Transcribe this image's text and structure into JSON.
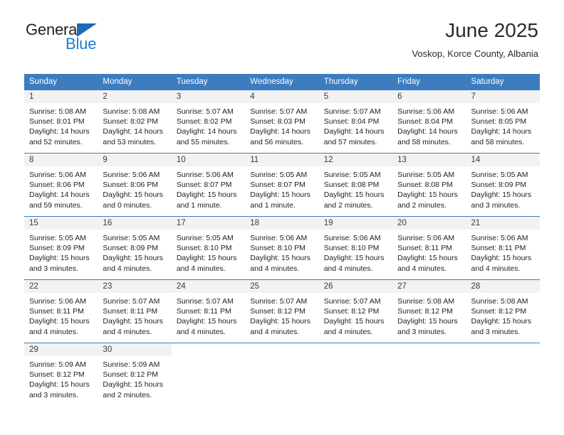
{
  "brand": {
    "line1": "General",
    "line2": "Blue",
    "triangle_color": "#1b6cb5",
    "blue_text_color": "#1b7fd4"
  },
  "header": {
    "title": "June 2025",
    "subtitle": "Voskop, Korce County, Albania"
  },
  "theme": {
    "header_bg": "#3c7cbf",
    "daynum_bg": "#f2f2f2",
    "border": "#3c7cbf"
  },
  "weekday_headers": [
    "Sunday",
    "Monday",
    "Tuesday",
    "Wednesday",
    "Thursday",
    "Friday",
    "Saturday"
  ],
  "weeks": [
    [
      {
        "day": "1",
        "sunrise": "Sunrise: 5:08 AM",
        "sunset": "Sunset: 8:01 PM",
        "daylight1": "Daylight: 14 hours",
        "daylight2": "and 52 minutes."
      },
      {
        "day": "2",
        "sunrise": "Sunrise: 5:08 AM",
        "sunset": "Sunset: 8:02 PM",
        "daylight1": "Daylight: 14 hours",
        "daylight2": "and 53 minutes."
      },
      {
        "day": "3",
        "sunrise": "Sunrise: 5:07 AM",
        "sunset": "Sunset: 8:02 PM",
        "daylight1": "Daylight: 14 hours",
        "daylight2": "and 55 minutes."
      },
      {
        "day": "4",
        "sunrise": "Sunrise: 5:07 AM",
        "sunset": "Sunset: 8:03 PM",
        "daylight1": "Daylight: 14 hours",
        "daylight2": "and 56 minutes."
      },
      {
        "day": "5",
        "sunrise": "Sunrise: 5:07 AM",
        "sunset": "Sunset: 8:04 PM",
        "daylight1": "Daylight: 14 hours",
        "daylight2": "and 57 minutes."
      },
      {
        "day": "6",
        "sunrise": "Sunrise: 5:06 AM",
        "sunset": "Sunset: 8:04 PM",
        "daylight1": "Daylight: 14 hours",
        "daylight2": "and 58 minutes."
      },
      {
        "day": "7",
        "sunrise": "Sunrise: 5:06 AM",
        "sunset": "Sunset: 8:05 PM",
        "daylight1": "Daylight: 14 hours",
        "daylight2": "and 58 minutes."
      }
    ],
    [
      {
        "day": "8",
        "sunrise": "Sunrise: 5:06 AM",
        "sunset": "Sunset: 8:06 PM",
        "daylight1": "Daylight: 14 hours",
        "daylight2": "and 59 minutes."
      },
      {
        "day": "9",
        "sunrise": "Sunrise: 5:06 AM",
        "sunset": "Sunset: 8:06 PM",
        "daylight1": "Daylight: 15 hours",
        "daylight2": "and 0 minutes."
      },
      {
        "day": "10",
        "sunrise": "Sunrise: 5:06 AM",
        "sunset": "Sunset: 8:07 PM",
        "daylight1": "Daylight: 15 hours",
        "daylight2": "and 1 minute."
      },
      {
        "day": "11",
        "sunrise": "Sunrise: 5:05 AM",
        "sunset": "Sunset: 8:07 PM",
        "daylight1": "Daylight: 15 hours",
        "daylight2": "and 1 minute."
      },
      {
        "day": "12",
        "sunrise": "Sunrise: 5:05 AM",
        "sunset": "Sunset: 8:08 PM",
        "daylight1": "Daylight: 15 hours",
        "daylight2": "and 2 minutes."
      },
      {
        "day": "13",
        "sunrise": "Sunrise: 5:05 AM",
        "sunset": "Sunset: 8:08 PM",
        "daylight1": "Daylight: 15 hours",
        "daylight2": "and 2 minutes."
      },
      {
        "day": "14",
        "sunrise": "Sunrise: 5:05 AM",
        "sunset": "Sunset: 8:09 PM",
        "daylight1": "Daylight: 15 hours",
        "daylight2": "and 3 minutes."
      }
    ],
    [
      {
        "day": "15",
        "sunrise": "Sunrise: 5:05 AM",
        "sunset": "Sunset: 8:09 PM",
        "daylight1": "Daylight: 15 hours",
        "daylight2": "and 3 minutes."
      },
      {
        "day": "16",
        "sunrise": "Sunrise: 5:05 AM",
        "sunset": "Sunset: 8:09 PM",
        "daylight1": "Daylight: 15 hours",
        "daylight2": "and 4 minutes."
      },
      {
        "day": "17",
        "sunrise": "Sunrise: 5:05 AM",
        "sunset": "Sunset: 8:10 PM",
        "daylight1": "Daylight: 15 hours",
        "daylight2": "and 4 minutes."
      },
      {
        "day": "18",
        "sunrise": "Sunrise: 5:06 AM",
        "sunset": "Sunset: 8:10 PM",
        "daylight1": "Daylight: 15 hours",
        "daylight2": "and 4 minutes."
      },
      {
        "day": "19",
        "sunrise": "Sunrise: 5:06 AM",
        "sunset": "Sunset: 8:10 PM",
        "daylight1": "Daylight: 15 hours",
        "daylight2": "and 4 minutes."
      },
      {
        "day": "20",
        "sunrise": "Sunrise: 5:06 AM",
        "sunset": "Sunset: 8:11 PM",
        "daylight1": "Daylight: 15 hours",
        "daylight2": "and 4 minutes."
      },
      {
        "day": "21",
        "sunrise": "Sunrise: 5:06 AM",
        "sunset": "Sunset: 8:11 PM",
        "daylight1": "Daylight: 15 hours",
        "daylight2": "and 4 minutes."
      }
    ],
    [
      {
        "day": "22",
        "sunrise": "Sunrise: 5:06 AM",
        "sunset": "Sunset: 8:11 PM",
        "daylight1": "Daylight: 15 hours",
        "daylight2": "and 4 minutes."
      },
      {
        "day": "23",
        "sunrise": "Sunrise: 5:07 AM",
        "sunset": "Sunset: 8:11 PM",
        "daylight1": "Daylight: 15 hours",
        "daylight2": "and 4 minutes."
      },
      {
        "day": "24",
        "sunrise": "Sunrise: 5:07 AM",
        "sunset": "Sunset: 8:11 PM",
        "daylight1": "Daylight: 15 hours",
        "daylight2": "and 4 minutes."
      },
      {
        "day": "25",
        "sunrise": "Sunrise: 5:07 AM",
        "sunset": "Sunset: 8:12 PM",
        "daylight1": "Daylight: 15 hours",
        "daylight2": "and 4 minutes."
      },
      {
        "day": "26",
        "sunrise": "Sunrise: 5:07 AM",
        "sunset": "Sunset: 8:12 PM",
        "daylight1": "Daylight: 15 hours",
        "daylight2": "and 4 minutes."
      },
      {
        "day": "27",
        "sunrise": "Sunrise: 5:08 AM",
        "sunset": "Sunset: 8:12 PM",
        "daylight1": "Daylight: 15 hours",
        "daylight2": "and 3 minutes."
      },
      {
        "day": "28",
        "sunrise": "Sunrise: 5:08 AM",
        "sunset": "Sunset: 8:12 PM",
        "daylight1": "Daylight: 15 hours",
        "daylight2": "and 3 minutes."
      }
    ],
    [
      {
        "day": "29",
        "sunrise": "Sunrise: 5:09 AM",
        "sunset": "Sunset: 8:12 PM",
        "daylight1": "Daylight: 15 hours",
        "daylight2": "and 3 minutes."
      },
      {
        "day": "30",
        "sunrise": "Sunrise: 5:09 AM",
        "sunset": "Sunset: 8:12 PM",
        "daylight1": "Daylight: 15 hours",
        "daylight2": "and 2 minutes."
      },
      {
        "day": "",
        "sunrise": "",
        "sunset": "",
        "daylight1": "",
        "daylight2": ""
      },
      {
        "day": "",
        "sunrise": "",
        "sunset": "",
        "daylight1": "",
        "daylight2": ""
      },
      {
        "day": "",
        "sunrise": "",
        "sunset": "",
        "daylight1": "",
        "daylight2": ""
      },
      {
        "day": "",
        "sunrise": "",
        "sunset": "",
        "daylight1": "",
        "daylight2": ""
      },
      {
        "day": "",
        "sunrise": "",
        "sunset": "",
        "daylight1": "",
        "daylight2": ""
      }
    ]
  ]
}
